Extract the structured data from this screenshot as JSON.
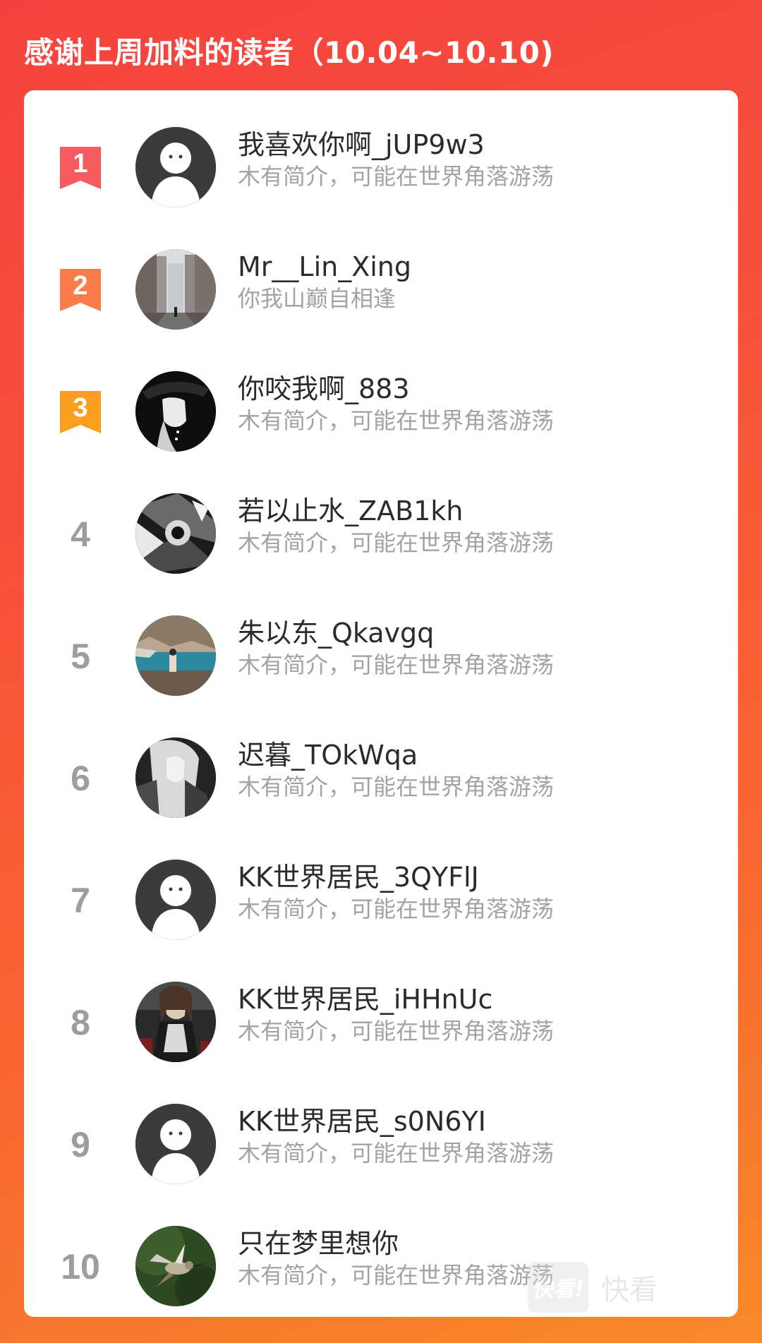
{
  "header": {
    "title": "感谢上周加料的读者（10.04~10.10)"
  },
  "colors": {
    "rank1": "#f55a5e",
    "rank2": "#fa7c4a",
    "rank3": "#fb9d1f",
    "rank_plain": "#9d9d9d"
  },
  "readers": [
    {
      "rank": "1",
      "name": "我喜欢你啊_jUP9w3",
      "bio": "木有简介，可能在世界角落游荡",
      "avatar": "default-avatar-icon"
    },
    {
      "rank": "2",
      "name": "Mr__Lin_Xing",
      "bio": "你我山巅自相逢",
      "avatar": "city-street-photo"
    },
    {
      "rank": "3",
      "name": "你咬我啊_883",
      "bio": "木有简介，可能在世界角落游荡",
      "avatar": "hat-portrait-photo"
    },
    {
      "rank": "4",
      "name": "若以止水_ZAB1kh",
      "bio": "木有简介，可能在世界角落游荡",
      "avatar": "monochrome-art-photo"
    },
    {
      "rank": "5",
      "name": "朱以东_Qkavgq",
      "bio": "木有简介，可能在世界角落游荡",
      "avatar": "lake-scene-photo"
    },
    {
      "rank": "6",
      "name": "迟暮_TOkWqa",
      "bio": "木有简介，可能在世界角落游荡",
      "avatar": "white-hair-portrait-photo"
    },
    {
      "rank": "7",
      "name": "KK世界居民_3QYFlJ",
      "bio": "木有简介，可能在世界角落游荡",
      "avatar": "default-avatar-icon"
    },
    {
      "rank": "8",
      "name": "KK世界居民_iHHnUc",
      "bio": "木有简介，可能在世界角落游荡",
      "avatar": "stage-portrait-photo"
    },
    {
      "rank": "9",
      "name": "KK世界居民_s0N6YI",
      "bio": "木有简介，可能在世界角落游荡",
      "avatar": "default-avatar-icon"
    },
    {
      "rank": "10",
      "name": "只在梦里想你",
      "bio": "木有简介，可能在世界角落游荡",
      "avatar": "hummingbird-photo"
    }
  ],
  "watermark": {
    "logo_text": "快看!",
    "text": "快看"
  }
}
